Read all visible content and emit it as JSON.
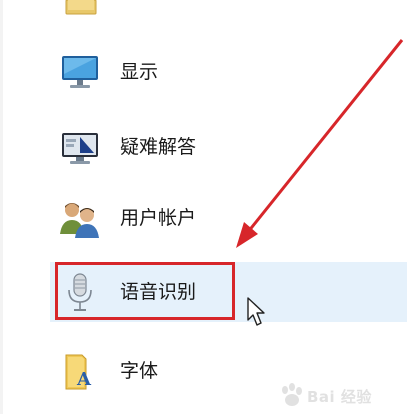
{
  "panel": {
    "items": [
      {
        "label": "显示",
        "icon": "monitor-icon"
      },
      {
        "label": "疑难解答",
        "icon": "troubleshoot-icon"
      },
      {
        "label": "用户帐户",
        "icon": "user-accounts-icon"
      },
      {
        "label": "语音识别",
        "icon": "microphone-icon",
        "selected": true
      },
      {
        "label": "字体",
        "icon": "font-folder-icon"
      }
    ]
  },
  "annotation": {
    "highlight_color": "#d7262a",
    "selected_bg": "#e5f1fb"
  },
  "watermark": {
    "text": "Bai 经验"
  }
}
